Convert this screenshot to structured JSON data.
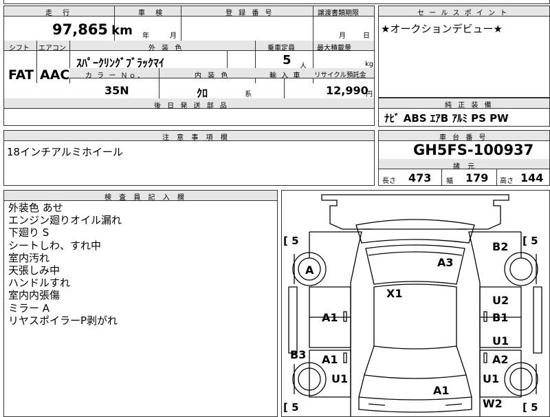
{
  "top_header": {
    "mileage_label": "走 行",
    "inspection_label": "車 検",
    "reg_number_label": "登 録 番 号",
    "transfer_deadline_label": "譲渡書類期限"
  },
  "mileage": {
    "value": "97,865",
    "unit": "km"
  },
  "inspection": {
    "year_label": "年",
    "month_label": "月"
  },
  "transfer_deadline": {
    "month_label": "月",
    "day_label": "日"
  },
  "spec": {
    "shift_label": "シフト",
    "aircon_label": "エアコン",
    "exterior_color_label": "外 装 色",
    "capacity_label": "乗車定員",
    "max_load_label": "最大積載量",
    "shift_value": "FAT",
    "aircon_value": "AAC",
    "exterior_color_value": "ｽﾊﾟｰｸﾘﾝｸﾞﾌﾞﾗｯｸﾏｲ",
    "capacity_value": "5",
    "capacity_unit": "人",
    "max_load_unit": "kg",
    "color_no_label": "カ ラ ー Ｎｏ．",
    "interior_color_label": "内 装 色",
    "import_label": "輸 入 車",
    "recycle_label": "リサイクル預託金",
    "color_no_value": "35N",
    "interior_color_value": "ｸﾛ",
    "interior_color_suffix": "系",
    "recycle_value": "12,990",
    "recycle_unit": "円",
    "later_parts_label": "後 日 発 送 部 品"
  },
  "sales_point": {
    "label": "セ ー ル ス ポ イ ン ト",
    "text": "★オークションデビュー★"
  },
  "genuine_equipment": {
    "label": "純 正 装 備",
    "items": "ﾅﾋﾞ ABS ｴｱB ｱﾙﾐ PS PW"
  },
  "caution": {
    "label": "注 意 事 項 欄",
    "text": "18インチアルミホイール"
  },
  "chassis": {
    "label": "車 台 番 号",
    "value": "GH5FS-100937",
    "specs_label": "諸 元",
    "length_label": "長さ",
    "length_value": "473",
    "width_label": "幅",
    "width_value": "179",
    "height_label": "高さ",
    "height_value": "144"
  },
  "inspector": {
    "label": "検 査 員 記 入 欄",
    "notes": [
      "外装色 あせ",
      "エンジン廻りオイル漏れ",
      "下廻り S",
      "シートしわ、すれ中",
      "室内汚れ",
      "天張しみ中",
      "ハンドルすれ",
      "室内内張傷",
      "ミラー A",
      "リヤスポイラーP剥がれ"
    ]
  },
  "diagram": {
    "tire_depth_labels": [
      "[ 5",
      "[ 5",
      "[ 5",
      "[ 5"
    ],
    "damage_marks": [
      "A",
      "A3",
      "B2",
      "X1",
      "A1",
      "U2",
      "B1",
      "U1",
      "B3",
      "A1",
      "A2",
      "U1",
      "U1",
      "A1",
      "W2"
    ]
  }
}
